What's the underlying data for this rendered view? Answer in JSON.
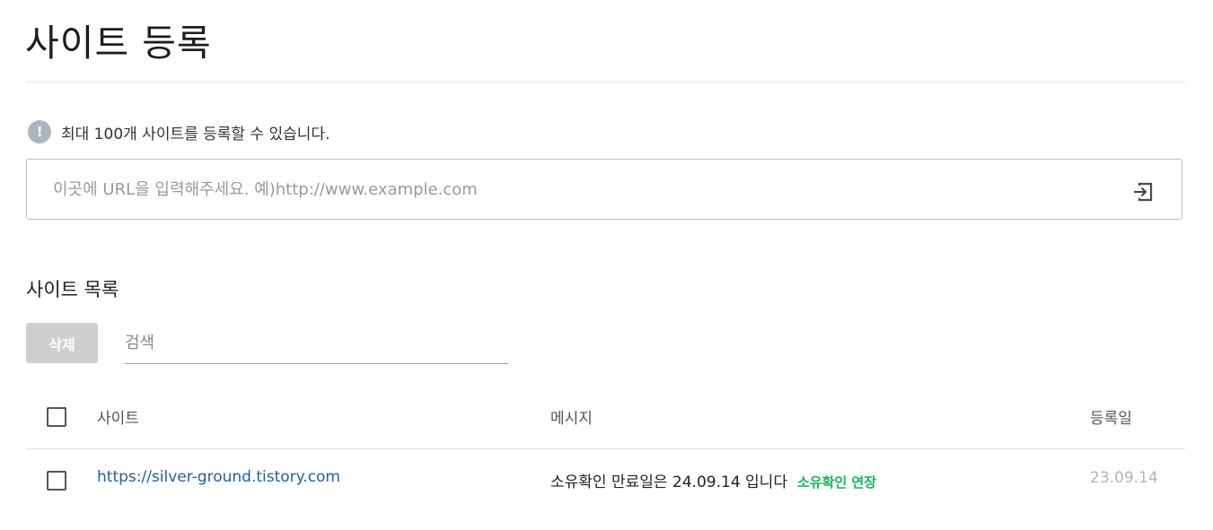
{
  "header": {
    "title": "사이트 등록"
  },
  "notice": {
    "icon": "exclamation-circle-icon",
    "icon_glyph": "!",
    "text": "최대 100개 사이트를 등록할 수 있습니다."
  },
  "url_input": {
    "placeholder": "이곳에 URL을 입력해주세요. 예)http://www.example.com",
    "value": "",
    "submit_icon": "enter-arrow-icon"
  },
  "site_list": {
    "title": "사이트 목록",
    "delete_label": "삭제",
    "search_placeholder": "검색",
    "columns": [
      "사이트",
      "메시지",
      "등록일"
    ],
    "rows": [
      {
        "site": "https://silver-ground.tistory.com",
        "message": "소유확인 만료일은 24.09.14 입니다",
        "action": "소유확인 연장",
        "date": "23.09.14",
        "checked": false
      }
    ]
  },
  "colors": {
    "link": "#1f5fa8",
    "action": "#18b35a",
    "disabled_button": "#cfcfcf",
    "notice_icon": "#aeb6bd"
  }
}
